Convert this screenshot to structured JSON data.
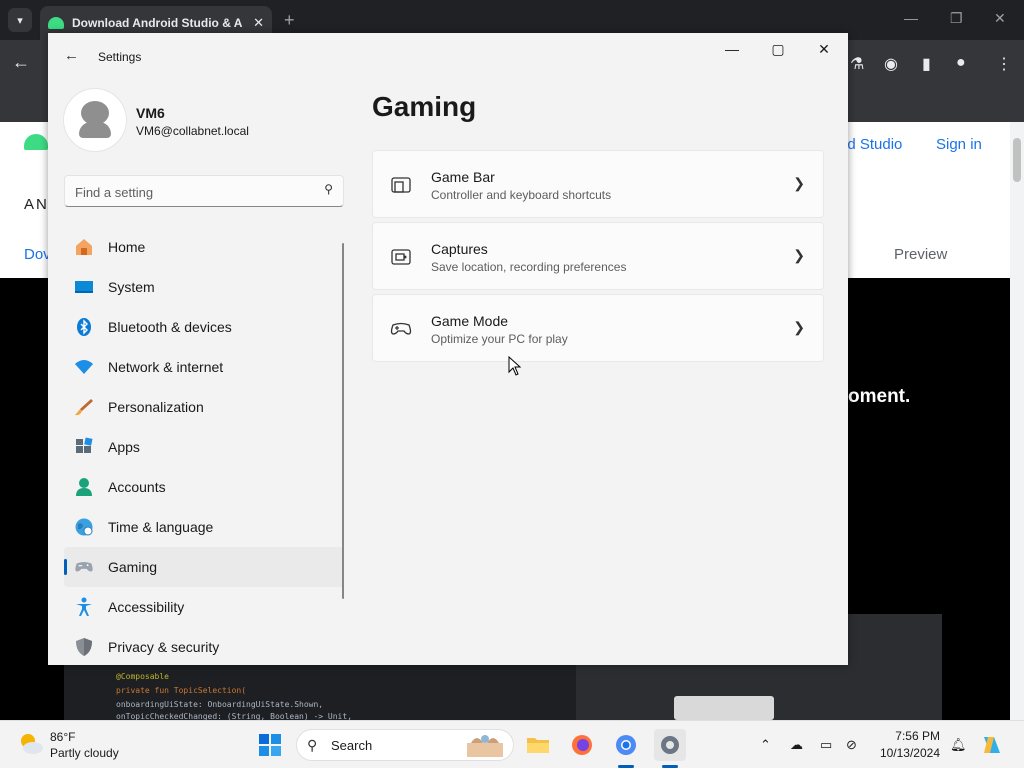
{
  "browser": {
    "tab_title": "Download Android Studio & A",
    "page_nav": {
      "product_link": "id Studio",
      "sign_in": "Sign in",
      "preview": "Preview",
      "side_an": "AN",
      "side_dov": "Dov"
    },
    "hero_fragment": "oment.",
    "code_lines": [
      "@Composable",
      "private fun TopicSelection(",
      "    onboardingUiState: OnboardingUiState.Shown,",
      "    onTopicCheckedChanged: (String, Boolean) -> Unit,"
    ]
  },
  "settings": {
    "window_title": "Settings",
    "user": {
      "name": "VM6",
      "email": "VM6@collabnet.local"
    },
    "search": {
      "placeholder": "Find a setting"
    },
    "nav": [
      {
        "label": "Home",
        "icon": "home-icon"
      },
      {
        "label": "System",
        "icon": "system-icon"
      },
      {
        "label": "Bluetooth & devices",
        "icon": "bluetooth-icon"
      },
      {
        "label": "Network & internet",
        "icon": "wifi-icon"
      },
      {
        "label": "Personalization",
        "icon": "brush-icon"
      },
      {
        "label": "Apps",
        "icon": "apps-icon"
      },
      {
        "label": "Accounts",
        "icon": "accounts-icon"
      },
      {
        "label": "Time & language",
        "icon": "globe-icon"
      },
      {
        "label": "Gaming",
        "icon": "gamepad-icon",
        "selected": true
      },
      {
        "label": "Accessibility",
        "icon": "accessibility-icon"
      },
      {
        "label": "Privacy & security",
        "icon": "shield-icon"
      }
    ],
    "page_title": "Gaming",
    "cards": [
      {
        "title": "Game Bar",
        "description": "Controller and keyboard shortcuts",
        "icon": "game-bar-icon"
      },
      {
        "title": "Captures",
        "description": "Save location, recording preferences",
        "icon": "capture-icon"
      },
      {
        "title": "Game Mode",
        "description": "Optimize your PC for play",
        "icon": "game-mode-icon"
      }
    ]
  },
  "taskbar": {
    "weather": {
      "temp": "86°F",
      "condition": "Partly cloudy"
    },
    "search_label": "Search",
    "clock": {
      "time": "7:56 PM",
      "date": "10/13/2024"
    }
  },
  "colors": {
    "accent": "#005fb8",
    "android_green": "#3ddc84",
    "chrome_dark": "#202124"
  }
}
